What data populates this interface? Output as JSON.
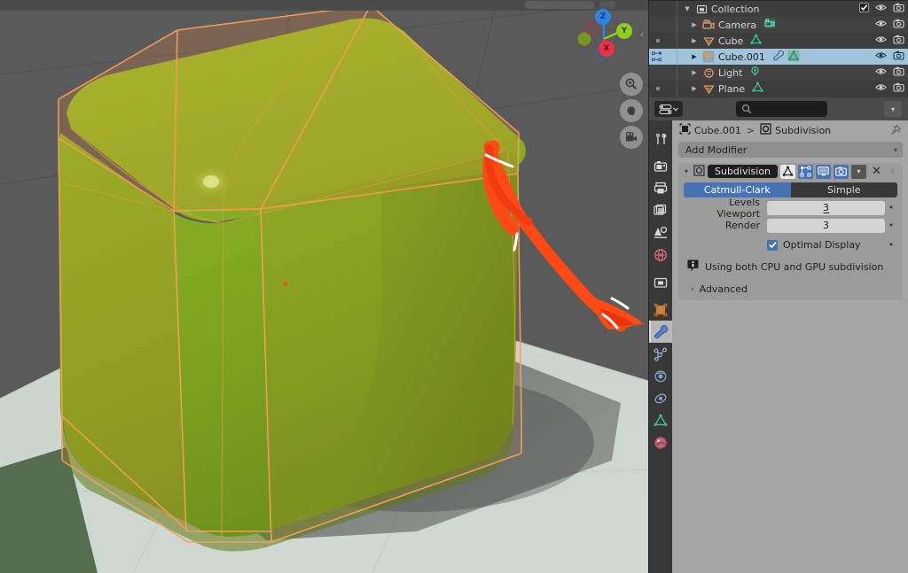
{
  "app": {
    "name": "Blender",
    "colors": {
      "viewport_bg": "#5a5a5a",
      "panel_bg": "#a5a5a5",
      "accent_blue": "#4772b3",
      "selection_highlight": "#a1c4da",
      "annotation_orange": "#ff4a15",
      "cube_green": "#7ea21e",
      "wire_orange": "#f0a868"
    }
  },
  "viewport": {
    "name": "3D Viewport",
    "gizmo": {
      "axes": [
        {
          "label": "Z",
          "color": "#2f83e3",
          "text_color": "#0a3d6b"
        },
        {
          "label": "Y",
          "color": "#8fce1c",
          "text_color": "#2d4a05"
        },
        {
          "label": "X",
          "color": "#f0304a",
          "text_color": "#5c0410"
        }
      ]
    },
    "tools": [
      {
        "name": "zoom-tool",
        "icon": "magnifier-icon"
      },
      {
        "name": "pan-tool",
        "icon": "hand-icon"
      },
      {
        "name": "camera-view-tool",
        "icon": "camera-icon"
      }
    ],
    "annotation": {
      "type": "freehand-arrow",
      "color": "#ff4a15",
      "description": "hand drawn arrow pointing from cube edge down-right"
    }
  },
  "outliner": {
    "name": "Outliner",
    "rows": [
      {
        "label": "Collection",
        "icon": "collection-icon",
        "indent": 0,
        "expanded": true,
        "selected": false,
        "gutter": "none",
        "checkbox": true,
        "eye": true,
        "camera": true,
        "sub_icons": []
      },
      {
        "label": "Camera",
        "icon": "camera-object-icon",
        "indent": 1,
        "expanded": false,
        "selected": false,
        "gutter": "none",
        "checkbox": false,
        "eye": true,
        "camera": true,
        "sub_icons": [
          "camera-data-icon"
        ]
      },
      {
        "label": "Cube",
        "icon": "mesh-object-icon",
        "indent": 1,
        "expanded": false,
        "selected": false,
        "gutter": "dot",
        "checkbox": false,
        "eye": true,
        "camera": true,
        "sub_icons": [
          "mesh-data-icon"
        ]
      },
      {
        "label": "Cube.001",
        "icon": "mesh-object-icon",
        "indent": 1,
        "expanded": false,
        "selected": true,
        "gutter": "relationship",
        "checkbox": false,
        "eye": true,
        "camera": true,
        "sub_icons": [
          "modifier-wrench-icon",
          "mesh-data-icon"
        ]
      },
      {
        "label": "Light",
        "icon": "light-object-icon",
        "indent": 1,
        "expanded": false,
        "selected": false,
        "gutter": "none",
        "checkbox": false,
        "eye": true,
        "camera": true,
        "sub_icons": [
          "light-data-icon"
        ]
      },
      {
        "label": "Plane",
        "icon": "mesh-object-icon",
        "indent": 1,
        "expanded": false,
        "selected": false,
        "gutter": "dot",
        "checkbox": false,
        "eye": true,
        "camera": true,
        "sub_icons": [
          "mesh-data-icon"
        ]
      }
    ]
  },
  "properties": {
    "name": "Properties",
    "editor_type_icon": "properties-editor-icon",
    "search_placeholder": "",
    "search_value": "",
    "breadcrumb": [
      {
        "label": "Cube.001",
        "icon": "object-icon"
      },
      {
        "label": "Subdivision",
        "icon": "modifier-data-icon"
      }
    ],
    "breadcrumb_separator": ">",
    "pin_icon": "pin-icon",
    "tabs": [
      {
        "name": "tool",
        "icon": "tool-icon",
        "active": false
      },
      {
        "name": "render",
        "icon": "render-camera-icon",
        "active": false
      },
      {
        "name": "output",
        "icon": "printer-icon",
        "active": false
      },
      {
        "name": "view-layer",
        "icon": "images-icon",
        "active": false
      },
      {
        "name": "scene",
        "icon": "scene-cone-icon",
        "active": false
      },
      {
        "name": "world",
        "icon": "world-globe-icon",
        "active": false
      },
      {
        "name": "collection",
        "icon": "collection-box-icon",
        "active": false
      },
      {
        "name": "object",
        "icon": "object-square-icon",
        "active": false
      },
      {
        "name": "modifiers",
        "icon": "wrench-icon",
        "active": true
      },
      {
        "name": "particles",
        "icon": "particles-icon",
        "active": false
      },
      {
        "name": "physics",
        "icon": "physics-orbit-icon",
        "active": false
      },
      {
        "name": "constraints",
        "icon": "constraint-icon",
        "active": false
      },
      {
        "name": "object-data",
        "icon": "mesh-data-green-icon",
        "active": false
      },
      {
        "name": "material",
        "icon": "material-sphere-icon",
        "active": false
      }
    ],
    "add_modifier": {
      "label": "Add Modifier",
      "chevron": "chevron-down-icon"
    },
    "modifier": {
      "expand_chevron": "chevron-down-icon",
      "type_icon": "modifier-data-icon",
      "name": "Subdivision",
      "header_toggles": [
        {
          "name": "on-cage-toggle",
          "icon": "triangle-vertex-icon",
          "state": "white"
        },
        {
          "name": "edit-mode-toggle",
          "icon": "edit-mode-icon",
          "state": "on"
        },
        {
          "name": "realtime-display-toggle",
          "icon": "monitor-icon",
          "state": "on"
        },
        {
          "name": "render-toggle",
          "icon": "camera-icon",
          "state": "on"
        }
      ],
      "extras_chevron": "chevron-down-icon",
      "close_icon": "close-x-icon",
      "drag_handle_icon": "drag-dots-icon",
      "algorithm": {
        "options": [
          "Catmull-Clark",
          "Simple"
        ],
        "selected": "Catmull-Clark"
      },
      "fields": [
        {
          "label": "Levels Viewport",
          "value": "3",
          "animate_dot": true
        },
        {
          "label": "Render",
          "value": "3",
          "animate_dot": true
        }
      ],
      "checkboxes": [
        {
          "label": "Optimal Display",
          "checked": true,
          "animate_dot": true
        }
      ],
      "info": {
        "icon": "info-icon",
        "text": "Using both CPU and GPU subdivision"
      },
      "advanced": {
        "label": "Advanced",
        "chevron": "chevron-right-icon",
        "expanded": false
      }
    }
  }
}
